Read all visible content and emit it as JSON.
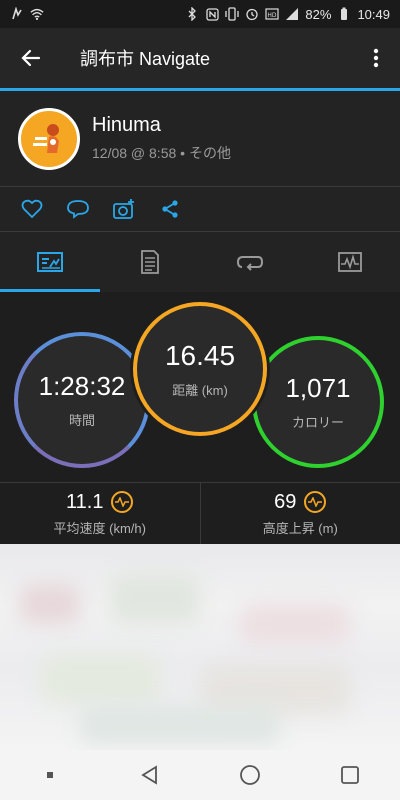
{
  "status_bar": {
    "battery": "82%",
    "time": "10:49",
    "icons": [
      "vibrate-icon",
      "wifi-icon",
      "bluetooth-icon",
      "nfc-icon",
      "vibrate-mode-icon",
      "alarm-icon",
      "hd-icon",
      "signal-icon",
      "battery-icon"
    ]
  },
  "app_bar": {
    "title": "調布市 Navigate",
    "back_icon": "back-arrow-icon",
    "more_icon": "more-vertical-icon"
  },
  "profile": {
    "name": "Hinuma",
    "meta": "12/08 @ 8:58 • その他",
    "avatar_icon": "avatar-icon"
  },
  "actions": [
    {
      "name": "like-button",
      "icon": "heart-icon"
    },
    {
      "name": "comment-button",
      "icon": "comment-icon"
    },
    {
      "name": "add-photo-button",
      "icon": "camera-add-icon"
    },
    {
      "name": "share-button",
      "icon": "share-icon"
    }
  ],
  "tabs": [
    {
      "name": "tab-overview",
      "icon": "overview-icon",
      "active": true
    },
    {
      "name": "tab-details",
      "icon": "document-icon",
      "active": false
    },
    {
      "name": "tab-laps",
      "icon": "loop-icon",
      "active": false
    },
    {
      "name": "tab-charts",
      "icon": "chart-icon",
      "active": false
    }
  ],
  "stats": {
    "time": {
      "value": "1:28:32",
      "label": "時間",
      "color": "#5b8fd9"
    },
    "distance": {
      "value": "16.45",
      "label": "距離 (km)",
      "color": "#f5a623"
    },
    "calories": {
      "value": "1,071",
      "label": "カロリー",
      "color": "#2ed12e"
    }
  },
  "metrics": [
    {
      "value": "11.1",
      "label": "平均速度 (km/h)",
      "icon": "activity-graph-icon"
    },
    {
      "value": "69",
      "label": "高度上昇 (m)",
      "icon": "activity-graph-icon"
    }
  ],
  "nav_bar": {
    "buttons": [
      "recent-dot-icon",
      "back-triangle-icon",
      "home-circle-icon",
      "overview-square-icon"
    ]
  },
  "colors": {
    "accent": "#2aa7e8",
    "background": "#1e1e1e",
    "panel": "#232323"
  }
}
